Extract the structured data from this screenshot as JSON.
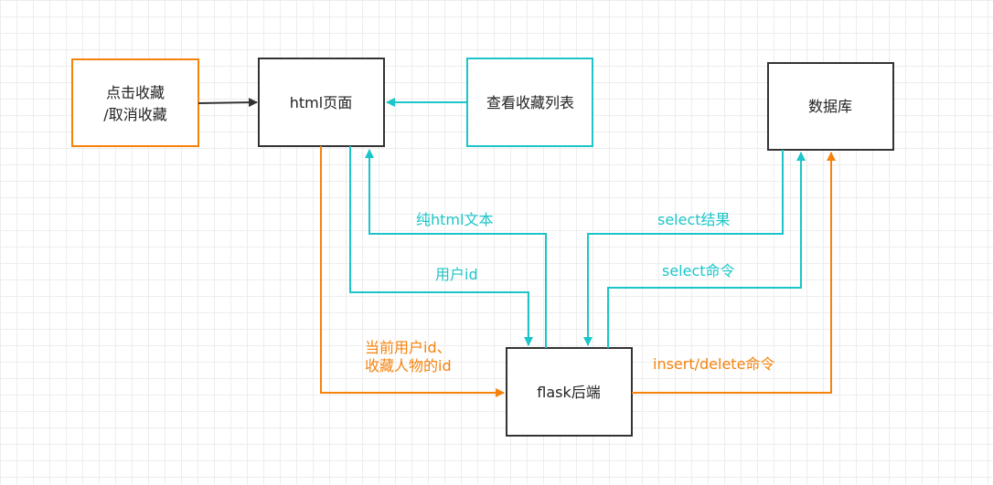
{
  "colors": {
    "teal": "#1BC5C9",
    "orange": "#F5820D",
    "black": "#333333",
    "box_border": "#333333",
    "grid": "#ededed"
  },
  "nodes": {
    "click_favorite_line1": "点击收藏",
    "click_favorite_line2": "/取消收藏",
    "html_page": "html页面",
    "view_list": "查看收藏列表",
    "database": "数据库",
    "flask_backend": "flask后端"
  },
  "edge_labels": {
    "pure_html": "纯html文本",
    "user_id": "用户id",
    "current_user_line1": "当前用户id、",
    "current_user_line2": "收藏人物的id",
    "select_result": "select结果",
    "select_cmd": "select命令",
    "insert_delete": "insert/delete命令"
  }
}
